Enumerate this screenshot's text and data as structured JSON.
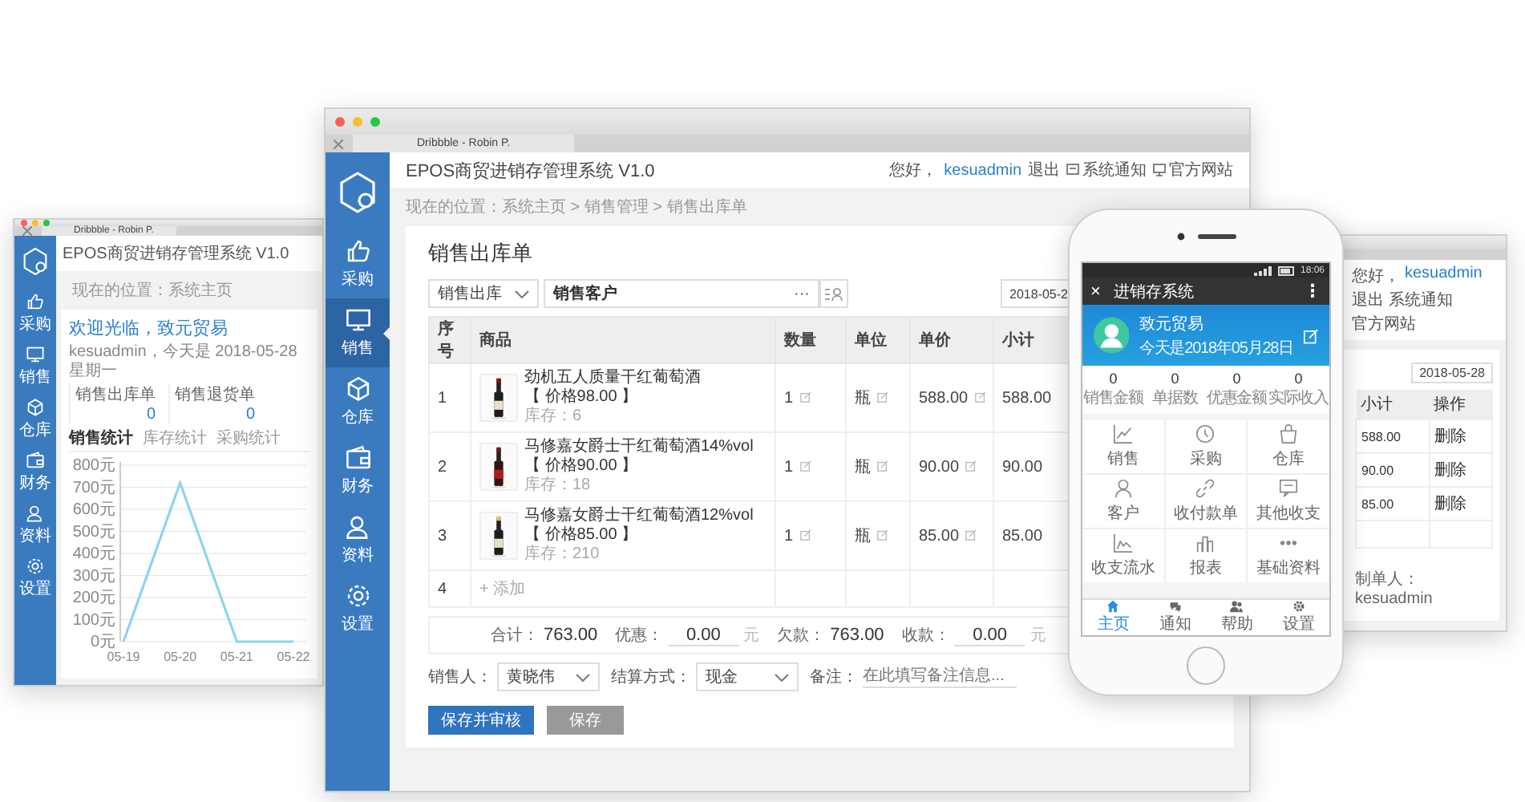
{
  "left_window": {
    "tab": "Dribbble - Robin P.",
    "title": "EPOS商贸进销存管理系统 V1.0",
    "sidebar": [
      {
        "label": "采购",
        "selected": false
      },
      {
        "label": "销售",
        "selected": false
      },
      {
        "label": "仓库",
        "selected": false
      },
      {
        "label": "财务",
        "selected": false
      },
      {
        "label": "资料",
        "selected": false
      },
      {
        "label": "设置",
        "selected": false
      }
    ],
    "breadcrumb": "现在的位置：系统主页",
    "welcome": "欢迎光临，致元贸易",
    "subline": "kesuadmin，今天是 2018-05-28 星期一",
    "stats": [
      {
        "label": "销售出库单",
        "value": "0"
      },
      {
        "label": "销售退货单",
        "value": "0"
      }
    ],
    "tabs": [
      {
        "label": "销售统计",
        "selected": true
      },
      {
        "label": "库存统计",
        "selected": false
      },
      {
        "label": "采购统计",
        "selected": false
      }
    ],
    "chart_data": {
      "type": "line",
      "categories": [
        "05-19",
        "05-20",
        "05-21",
        "05-22"
      ],
      "series": [
        {
          "color": "#8ed3f2",
          "values": [
            0,
            720,
            0,
            0
          ]
        }
      ],
      "ylim": [
        0,
        800
      ],
      "grid": true,
      "yticks": [
        {
          "value": 0,
          "label": "0元"
        },
        {
          "value": 100,
          "label": "100元"
        },
        {
          "value": 200,
          "label": "200元"
        },
        {
          "value": 300,
          "label": "300元"
        },
        {
          "value": 400,
          "label": "400元"
        },
        {
          "value": 500,
          "label": "500元"
        },
        {
          "value": 600,
          "label": "600元"
        },
        {
          "value": 700,
          "label": "700元"
        },
        {
          "value": 800,
          "label": "800元"
        }
      ]
    }
  },
  "main_window": {
    "tab": "Dribbble - Robin P.",
    "title": "EPOS商贸进销存管理系统 V1.0",
    "sidebar": [
      {
        "label": "采购",
        "selected": false
      },
      {
        "label": "销售",
        "selected": true
      },
      {
        "label": "仓库",
        "selected": false
      },
      {
        "label": "财务",
        "selected": false
      },
      {
        "label": "资料",
        "selected": false
      },
      {
        "label": "设置",
        "selected": false
      }
    ],
    "greeting": "您好，",
    "user": "kesuadmin",
    "links": [
      "退出",
      "系统通知",
      "官方网站"
    ],
    "breadcrumb": "现在的位置：系统主页 > 销售管理 > 销售出库单",
    "form_title": "销售出库单",
    "type_select": "销售出库",
    "customer": "销售客户",
    "more": "···",
    "date": "2018-05-2",
    "columns": [
      "序号",
      "商品",
      "数量",
      "单位",
      "单价",
      "小计"
    ],
    "rows": [
      {
        "no": "1",
        "name": "劲机五人质量干红葡萄酒",
        "price": "【 价格98.00 】",
        "stock": "库存：6",
        "qty": "1",
        "unit": "瓶",
        "unit_price": "588.00",
        "subtotal": "588.00"
      },
      {
        "no": "2",
        "name": "马修嘉女爵士干红葡萄酒14%vol",
        "price": "【 价格90.00 】",
        "stock": "库存：18",
        "qty": "1",
        "unit": "瓶",
        "unit_price": "90.00",
        "subtotal": "90.00"
      },
      {
        "no": "3",
        "name": "马修嘉女爵士干红葡萄酒12%vol",
        "price": "【 价格85.00 】",
        "stock": "库存：210",
        "qty": "1",
        "unit": "瓶",
        "unit_price": "85.00",
        "subtotal": "85.00"
      }
    ],
    "add_row": {
      "no": "4",
      "label": "+ 添加"
    },
    "totals": [
      {
        "label": "合计：",
        "value": "763.00",
        "kind": "text"
      },
      {
        "label": "优惠：",
        "value": "0.00",
        "unit": "元",
        "kind": "input"
      },
      {
        "label": "欠款：",
        "value": "763.00",
        "kind": "text"
      },
      {
        "label": "收款：",
        "value": "0.00",
        "unit": "元",
        "kind": "input"
      }
    ],
    "salesperson": {
      "label": "销售人：",
      "value": "黄晓伟"
    },
    "settlement": {
      "label": "结算方式：",
      "value": "现金"
    },
    "note": {
      "label": "备注：",
      "placeholder": "在此填写备注信息..."
    },
    "buttons": [
      {
        "label": "保存并审核",
        "kind": "primary"
      },
      {
        "label": "保存",
        "kind": "secondary"
      }
    ]
  },
  "phone": {
    "status": "18:06",
    "close": "×",
    "title": "进销存系统",
    "menu": "⋮",
    "name": "致元贸易",
    "date": "今天是2018年05月28日",
    "stats": [
      {
        "value": "0",
        "label": "销售金额"
      },
      {
        "value": "0",
        "label": "单据数"
      },
      {
        "value": "0",
        "label": "优惠金额"
      },
      {
        "value": "0",
        "label": "实际收入"
      }
    ],
    "grid": [
      "销售",
      "采购",
      "仓库",
      "客户",
      "收付款单",
      "其他收支",
      "收支流水",
      "报表",
      "基础资料"
    ],
    "tabs": [
      {
        "label": "主页",
        "selected": true
      },
      {
        "label": "通知",
        "selected": false
      },
      {
        "label": "帮助",
        "selected": false
      },
      {
        "label": "设置",
        "selected": false
      }
    ]
  },
  "right_window": {
    "greeting": "您好，",
    "user": "kesuadmin",
    "links": [
      "退出",
      "系统通知",
      "官方网站"
    ],
    "date": "2018-05-28",
    "columns": [
      "小计",
      "操作"
    ],
    "rows": [
      {
        "subtotal": "588.00",
        "action": "删除"
      },
      {
        "subtotal": "90.00",
        "action": "删除"
      },
      {
        "subtotal": "85.00",
        "action": "删除"
      }
    ],
    "maker": "制单人：kesuadmin"
  }
}
